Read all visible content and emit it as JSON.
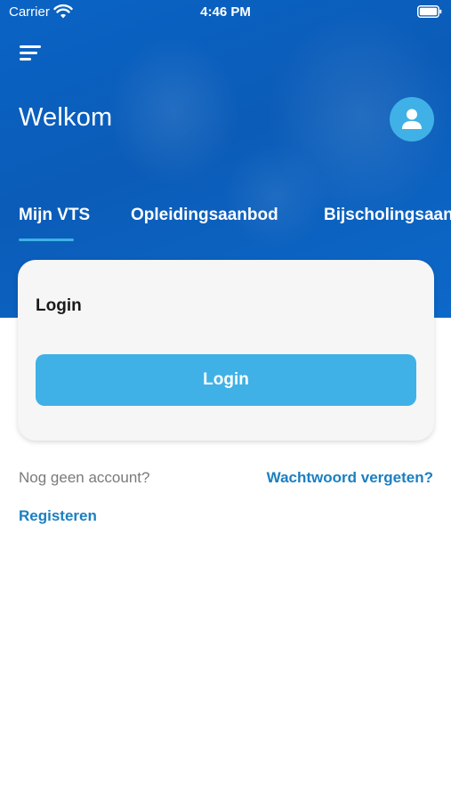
{
  "status_bar": {
    "carrier": "Carrier",
    "time": "4:46 PM",
    "icons": [
      "wifi-icon",
      "battery-icon"
    ]
  },
  "header": {
    "menu_icon": "menu-icon",
    "title": "Welkom",
    "avatar_icon": "user-icon"
  },
  "tabs": [
    {
      "label": "Mijn VTS",
      "active": true
    },
    {
      "label": "Opleidingsaanbod",
      "active": false
    },
    {
      "label": "Bijscholingsaanbod",
      "active": false
    }
  ],
  "login_card": {
    "title": "Login",
    "button_label": "Login"
  },
  "footer_links": {
    "no_account_text": "Nog geen account?",
    "forgot_password": "Wachtwoord vergeten?",
    "register": "Registeren"
  },
  "colors": {
    "header_blue": "#0b5cb8",
    "accent": "#3fb1e6",
    "link": "#1b7fc1"
  }
}
